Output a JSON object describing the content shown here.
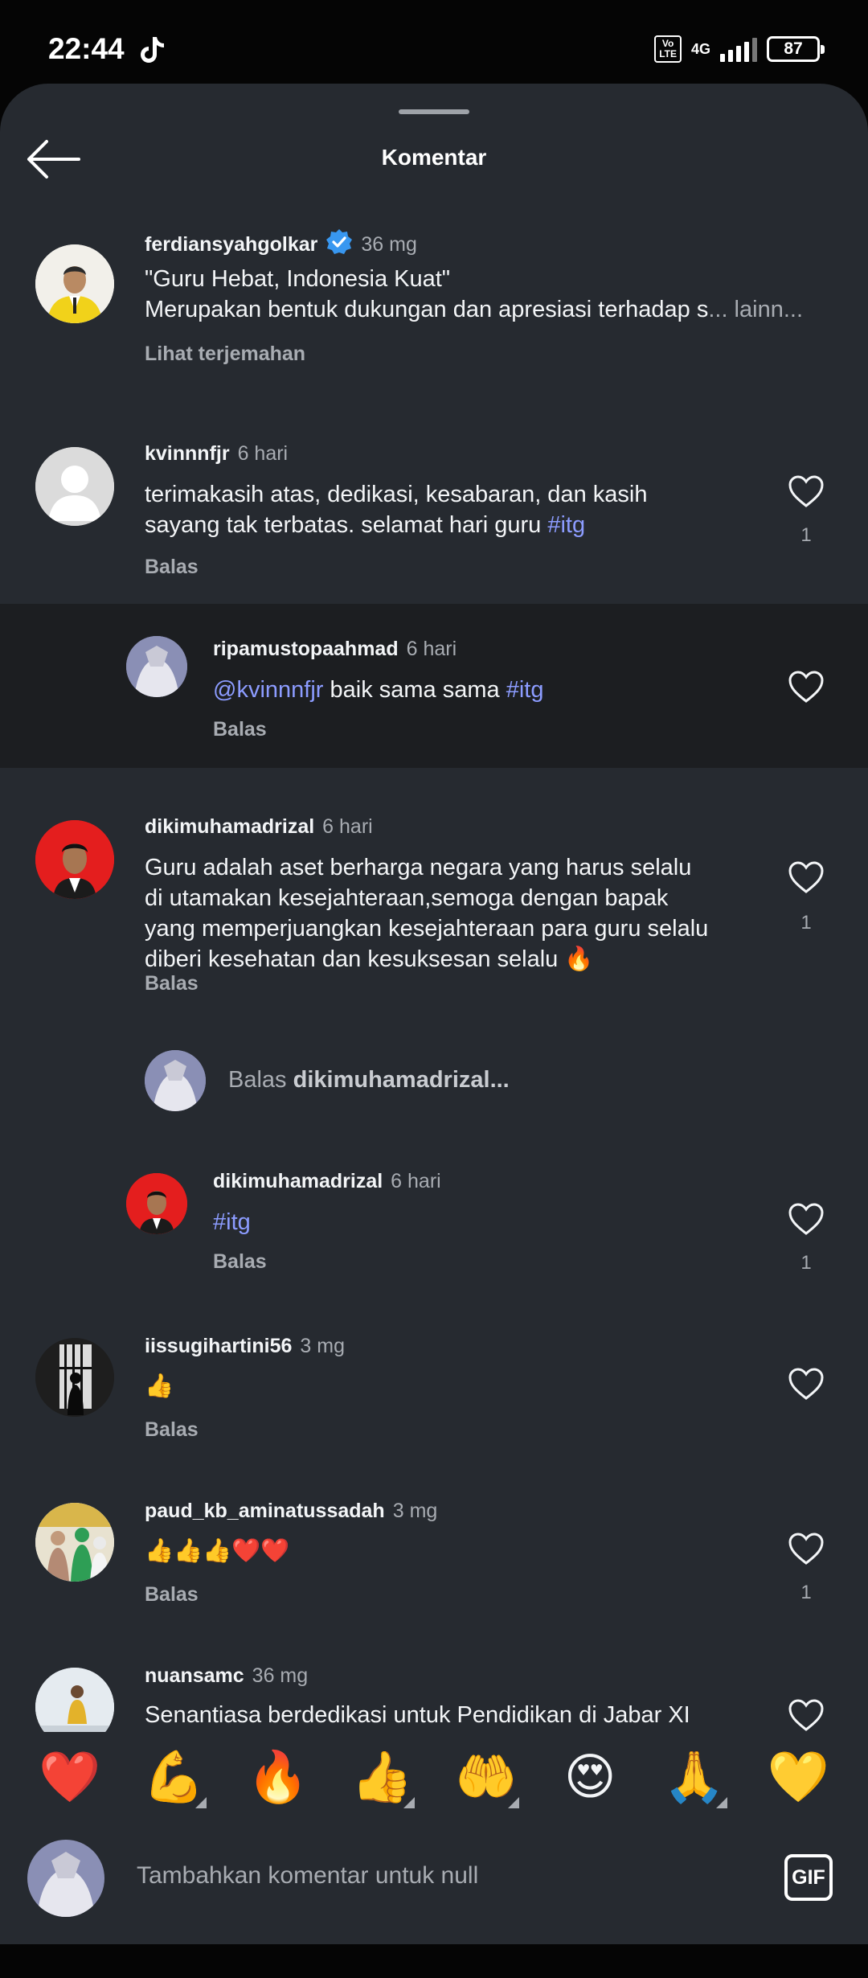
{
  "status": {
    "time": "22:44",
    "volte": "Vo LTE",
    "network": "4G",
    "battery": "87"
  },
  "header": {
    "title": "Komentar"
  },
  "comments": [
    {
      "username": "ferdiansyahgolkar",
      "time": "36 mg",
      "verified": true,
      "line1": "\"Guru Hebat, Indonesia Kuat\"",
      "line2": "Merupakan bentuk dukungan dan apresiasi terhadap s",
      "more": "... lainn...",
      "action": "Lihat terjemahan"
    },
    {
      "username": "kvinnnfjr",
      "time": "6 hari",
      "line1": "terimakasih atas, dedikasi, kesabaran, dan kasih",
      "line2": "sayang tak terbatas. selamat hari guru ",
      "tag": "#itg",
      "action": "Balas",
      "likes": "1"
    },
    {
      "username": "ripamustopaahmad",
      "time": "6 hari",
      "mention": "@kvinnnfjr",
      "text": " baik sama sama ",
      "tag": "#itg",
      "action": "Balas"
    },
    {
      "username": "dikimuhamadrizal",
      "time": "6 hari",
      "lines": [
        "Guru adalah aset berharga negara yang harus selalu",
        "di utamakan kesejahteraan,semoga dengan bapak",
        "yang memperjuangkan kesejahteraan para guru selalu",
        "diberi kesehatan dan kesuksesan selalu 🔥"
      ],
      "action": "Balas",
      "likes": "1"
    },
    {
      "username": "dikimuhamadrizal",
      "time": "6 hari",
      "tag": "#itg",
      "action": "Balas",
      "likes": "1"
    },
    {
      "username": "iissugihartini56",
      "time": "3 mg",
      "text": "👍",
      "action": "Balas"
    },
    {
      "username": "paud_kb_aminatussadah",
      "time": "3 mg",
      "text": "👍👍👍❤️❤️",
      "action": "Balas",
      "likes": "1"
    },
    {
      "username": "nuansamc",
      "time": "36 mg",
      "text": "Senantiasa berdedikasi untuk Pendidikan di Jabar XI"
    }
  ],
  "reply_prompt": {
    "prefix": "Balas ",
    "username": "dikimuhamadrizal..."
  },
  "emojis": [
    {
      "glyph": "❤️",
      "name": "red-heart"
    },
    {
      "glyph": "💪",
      "name": "flexed-biceps",
      "tone": true
    },
    {
      "glyph": "🔥",
      "name": "fire"
    },
    {
      "glyph": "👍",
      "name": "thumbs-up",
      "tone": true
    },
    {
      "glyph": "🤲",
      "name": "palms-up",
      "tone": true
    },
    {
      "glyph": "😍",
      "name": "heart-eyes"
    },
    {
      "glyph": "🙏",
      "name": "folded-hands",
      "tone": true
    },
    {
      "glyph": "💛",
      "name": "yellow-heart"
    }
  ],
  "composer": {
    "placeholder": "Tambahkan komentar untuk null",
    "gif_label": "GIF"
  },
  "colors": {
    "background": "#262a30",
    "highlight": "#1c1e21",
    "link": "#8c9cff",
    "verified": "#3897f0"
  }
}
